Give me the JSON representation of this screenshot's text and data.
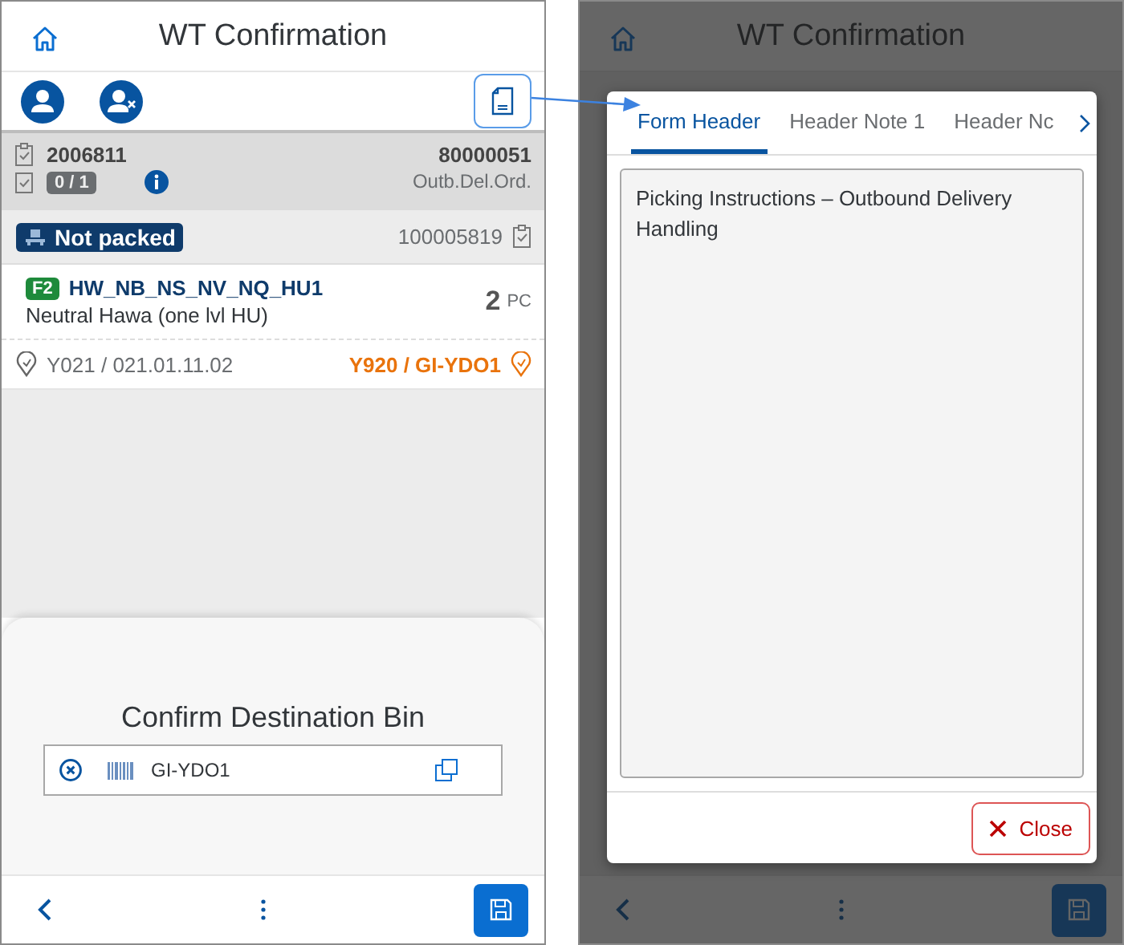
{
  "main_screen": {
    "title": "WT Confirmation",
    "task": {
      "warehouse_task": "2006811",
      "progress": "0 / 1",
      "document": "80000051",
      "document_type": "Outb.Del.Ord."
    },
    "packing": {
      "status": "Not packed",
      "handling_unit": "100005819"
    },
    "product": {
      "badge": "F2",
      "code": "HW_NB_NS_NV_NQ_HU1",
      "description": "Neutral Hawa (one lvl HU)",
      "quantity": "2",
      "unit": "PC"
    },
    "source_bin": "Y021 / 021.01.11.02",
    "destination_bin": "Y920 / GI-YDO1",
    "sheet": {
      "title": "Confirm Destination Bin",
      "field_value": "GI-YDO1"
    }
  },
  "dialog_screen": {
    "title": "WT Confirmation",
    "tabs": [
      {
        "label": "Form Header",
        "selected": true
      },
      {
        "label": "Header Note 1",
        "selected": false
      },
      {
        "label": "Header Nc",
        "selected": false
      }
    ],
    "note": "Picking Instructions – Outbound Delivery Handling",
    "close_button": "Close"
  }
}
